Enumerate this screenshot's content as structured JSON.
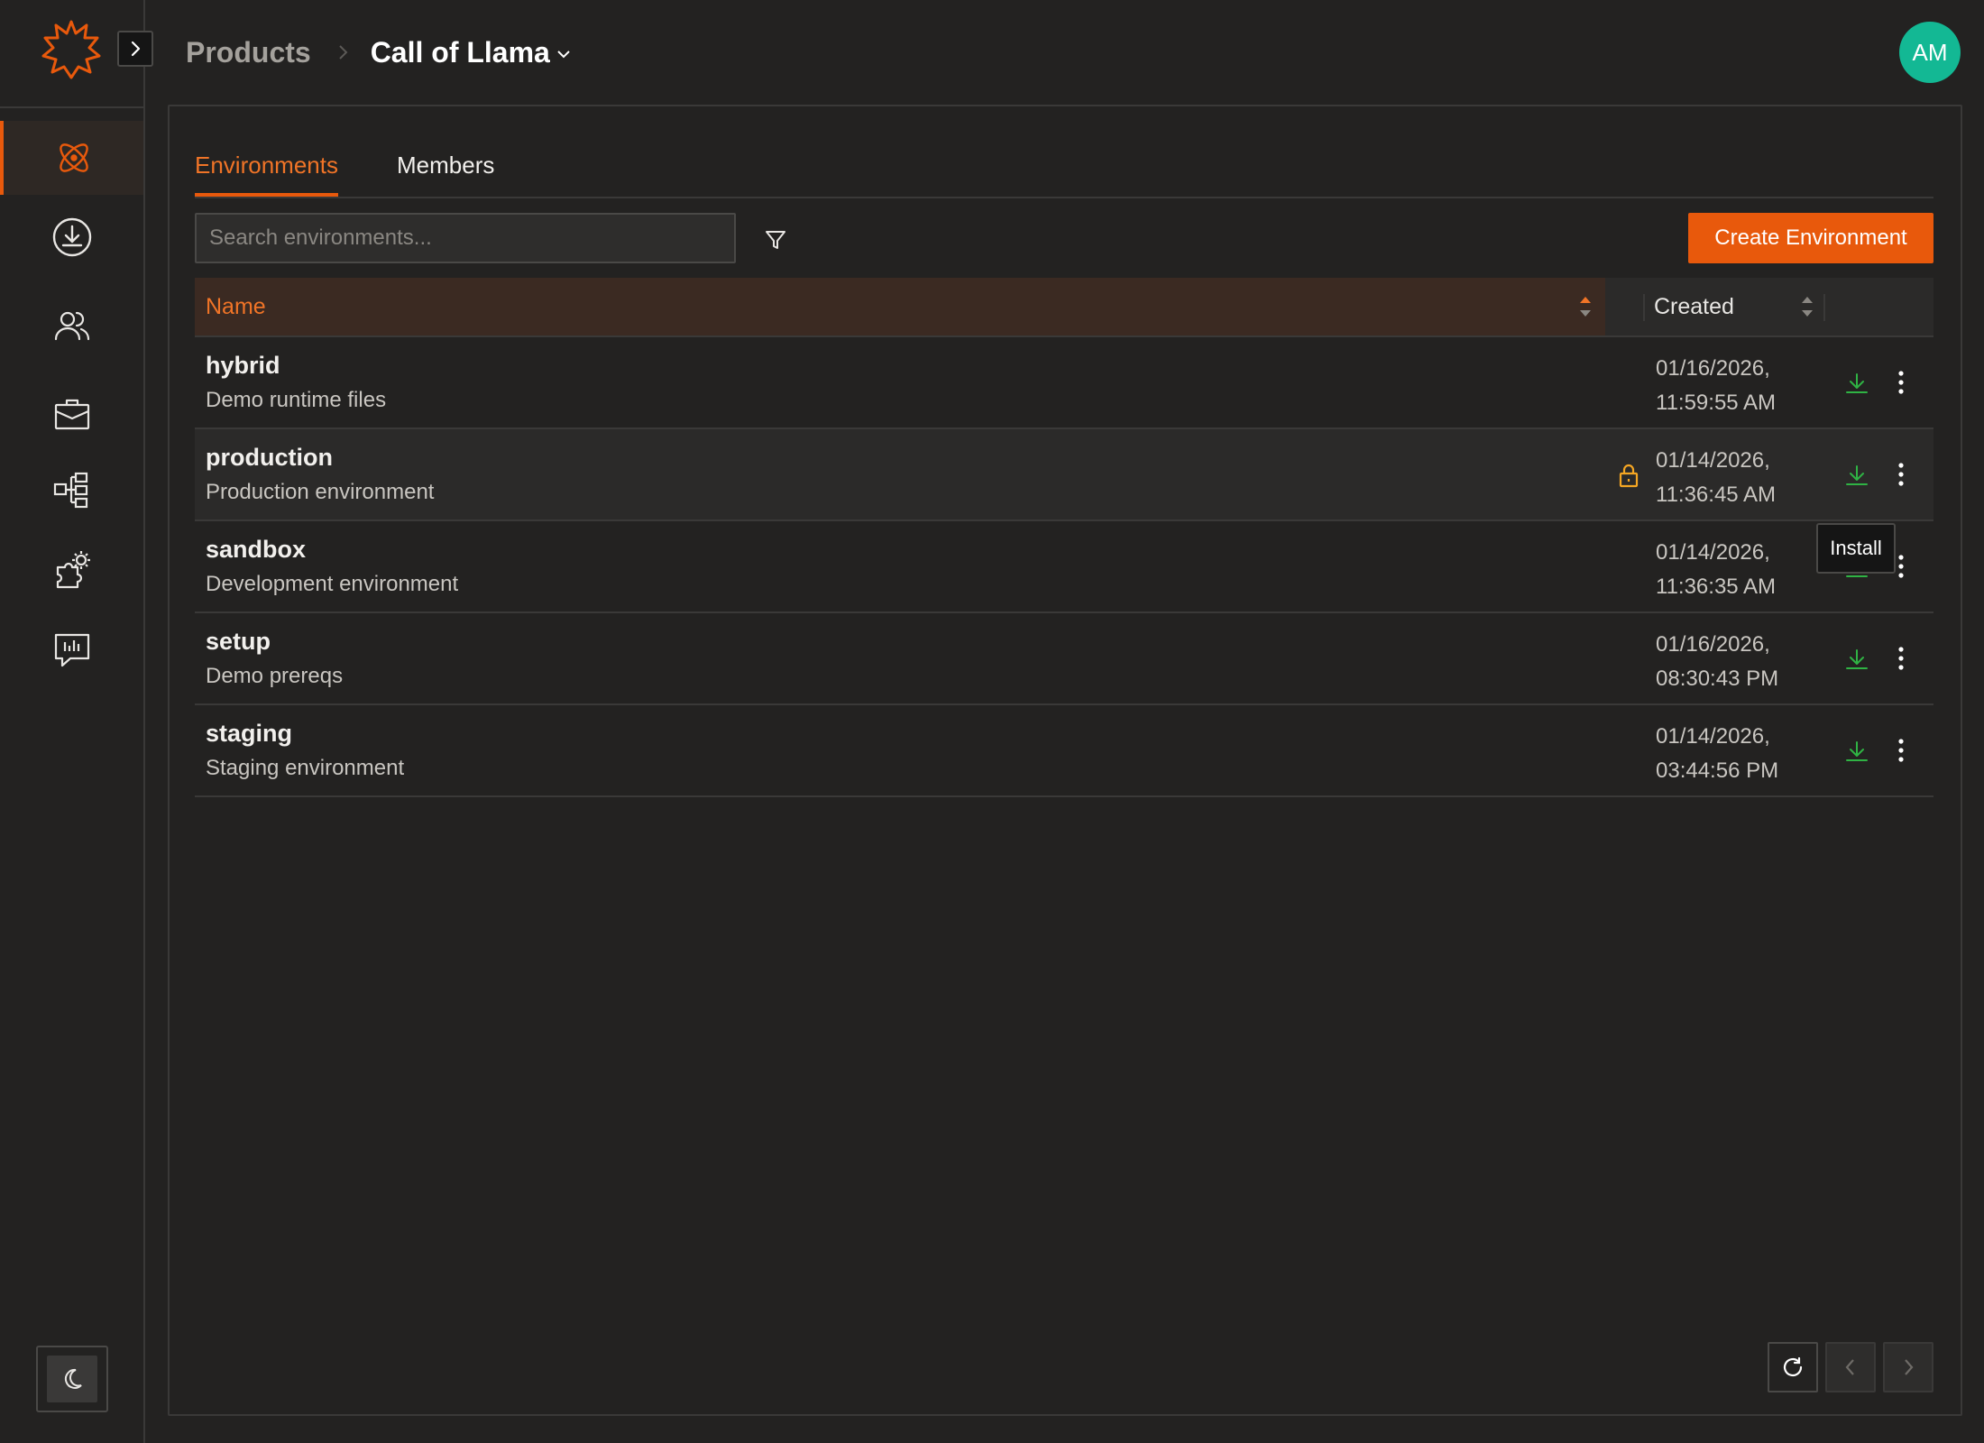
{
  "app": {
    "colors": {
      "accent": "#e8590c",
      "install": "#2fb344",
      "lock": "#f5a623",
      "avatar": "#13b894"
    }
  },
  "header": {
    "breadcrumb_parent": "Products",
    "breadcrumb_current": "Call of Llama",
    "avatar_initials": "AM"
  },
  "sidebar": {
    "items": [
      {
        "icon": "atom-icon",
        "active": true
      },
      {
        "icon": "download-circle-icon",
        "active": false
      },
      {
        "icon": "users-icon",
        "active": false
      },
      {
        "icon": "briefcase-icon",
        "active": false
      },
      {
        "icon": "hierarchy-icon",
        "active": false
      },
      {
        "icon": "puzzle-gear-icon",
        "active": false
      },
      {
        "icon": "feedback-icon",
        "active": false
      }
    ],
    "theme_toggle_icon": "moon-icon"
  },
  "tabs": [
    {
      "label": "Environments",
      "active": true
    },
    {
      "label": "Members",
      "active": false
    }
  ],
  "search": {
    "placeholder": "Search environments..."
  },
  "toolbar": {
    "create_label": "Create Environment"
  },
  "table": {
    "columns": {
      "name": "Name",
      "created": "Created"
    },
    "rows": [
      {
        "name": "hybrid",
        "description": "Demo runtime files",
        "date": "01/16/2026,",
        "time": "11:59:55 AM",
        "locked": false
      },
      {
        "name": "production",
        "description": "Production environment",
        "date": "01/14/2026,",
        "time": "11:36:45 AM",
        "locked": true
      },
      {
        "name": "sandbox",
        "description": "Development environment",
        "date": "01/14/2026,",
        "time": "11:36:35 AM",
        "locked": false
      },
      {
        "name": "setup",
        "description": "Demo prereqs",
        "date": "01/16/2026,",
        "time": "08:30:43 PM",
        "locked": false
      },
      {
        "name": "staging",
        "description": "Staging environment",
        "date": "01/14/2026,",
        "time": "03:44:56 PM",
        "locked": false
      }
    ]
  },
  "tooltip": {
    "text": "Install"
  }
}
